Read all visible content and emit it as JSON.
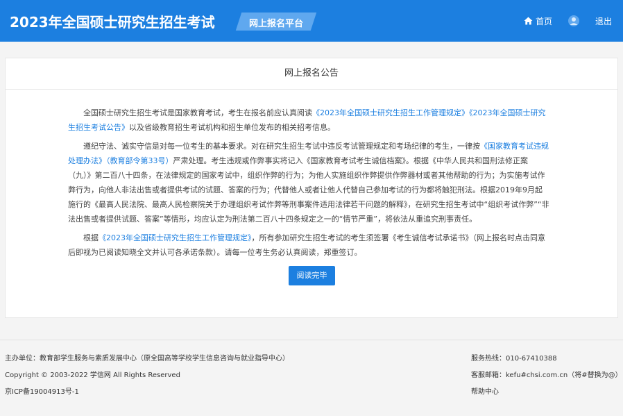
{
  "header": {
    "title": "2023年全国硕士研究生招生考试",
    "platform_label": "网上报名平台",
    "nav": {
      "home_label": "首页",
      "logout_label": "退出"
    }
  },
  "notice": {
    "title": "网上报名公告",
    "p1": {
      "t1": "全国硕士研究生招生考试是国家教育考试，考生在报名前应认真阅读",
      "l1": "《2023年全国硕士研究生招生工作管理规定》",
      "l2": "《2023年全国硕士研究生招生考试公告》",
      "t2": "以及省级教育招生考试机构和招生单位发布的相关招考信息。"
    },
    "p2": {
      "t1": "遵纪守法、诚实守信是对每一位考生的基本要求。对在研究生招生考试中违反考试管理规定和考场纪律的考生，一律按",
      "l1": "《国家教育考试违规处理办法》（教育部令第33号）",
      "t2": "严肃处理。考生违规或作弊事实将记入《国家教育考试考生诚信档案》。根据《中华人民共和国刑法修正案（九）》第二百八十四条，在法律规定的国家考试中，组织作弊的行为；为他人实施组织作弊提供作弊器材或者其他帮助的行为；为实施考试作弊行为，向他人非法出售或者提供考试的试题、答案的行为；代替他人或者让他人代替自己参加考试的行为都将触犯刑法。根据2019年9月起施行的《最高人民法院、最高人民检察院关于办理组织考试作弊等刑事案件适用法律若干问题的解释》，在研究生招生考试中“组织考试作弊”“非法出售或者提供试题、答案”等情形，均应认定为刑法第二百八十四条规定之一的“情节严重”，将依法从重追究刑事责任。"
    },
    "p3": {
      "t1": "根据",
      "l1": "《2023年全国硕士研究生招生工作管理规定》",
      "t2": "，所有参加研究生招生考试的考生须签署《考生诚信考试承诺书》（网上报名时点击同意后即视为已阅读知晓全文并认可各承诺条款）。请每一位考生务必认真阅读，郑重签订。"
    },
    "button_label": "阅读完毕"
  },
  "footer": {
    "host": "主办单位：教育部学生服务与素质发展中心（原全国高等学校学生信息咨询与就业指导中心）",
    "copyright": "Copyright © 2003-2022 学信网 All Rights Reserved",
    "icp": "京ICP备19004913号-1",
    "hotline": "服务热线：010-67410388",
    "email": "客服邮箱：kefu#chsi.com.cn（将#替换为@）",
    "help": "帮助中心"
  },
  "colors": {
    "primary": "#1c7fe0",
    "platform_badge": "#5fa8ef",
    "link": "#1c7fe0"
  },
  "icons": [
    "home-icon",
    "user-avatar-icon"
  ]
}
